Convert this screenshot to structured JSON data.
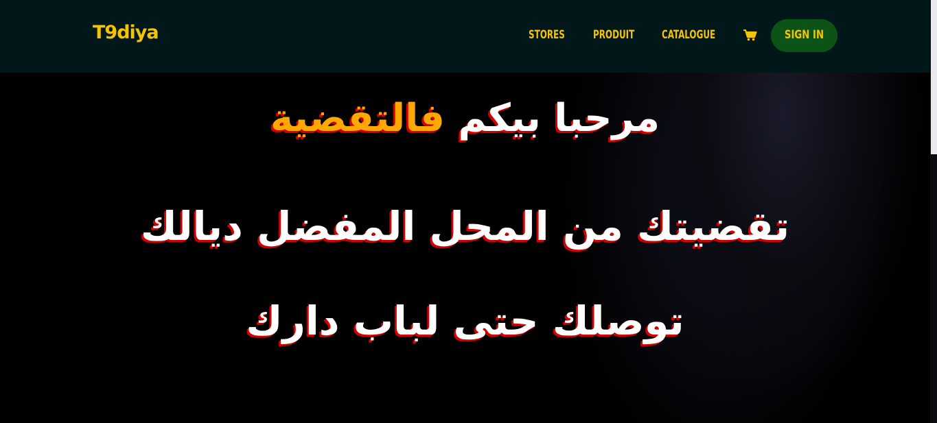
{
  "navbar": {
    "logo": "T9diya",
    "links": {
      "stores": "STORES",
      "produit": "PRODUIT",
      "catalogue": "CATALOGUE"
    },
    "cart_icon": "shopping-cart-icon",
    "signin_label": "SIGN IN"
  },
  "hero": {
    "line1_prefix": "مرحبا بيكم",
    "line1_highlight": "فالتقضية",
    "line2": "تقضيتك من المحل المفضل ديالك",
    "line3": "توصلك حتى لباب دارك"
  },
  "colors": {
    "accent_yellow": "#f5c400",
    "highlight_orange": "#ffa800",
    "navbar_bg": "#02171a",
    "signin_bg": "#0b5316",
    "text_shadow_red": "#d40000"
  }
}
